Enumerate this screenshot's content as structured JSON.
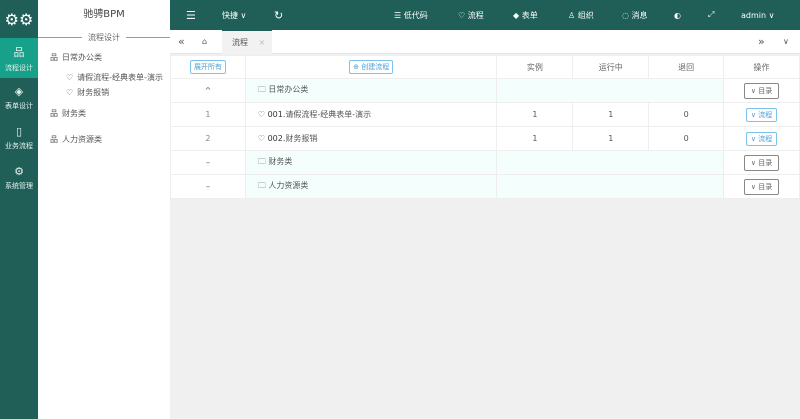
{
  "rail": {
    "items": [
      {
        "label": "流程设计",
        "icon": "sitemap-icon"
      },
      {
        "label": "表单设计",
        "icon": "layers-icon"
      },
      {
        "label": "业务流程",
        "icon": "tablet-icon"
      },
      {
        "label": "系统管理",
        "icon": "gear-icon"
      }
    ]
  },
  "side": {
    "title": "驰骋BPM",
    "section": "流程设计",
    "tree": [
      {
        "label": "日常办公类",
        "children": [
          "请假流程-经典表单-演示",
          "财务报销"
        ]
      },
      {
        "label": "财务类",
        "children": []
      },
      {
        "label": "人力资源类",
        "children": []
      }
    ]
  },
  "topbar": {
    "quick": "快捷",
    "items": [
      "低代码",
      "流程",
      "表单",
      "组织",
      "消息"
    ],
    "user": "admin"
  },
  "tabs": {
    "active": "流程"
  },
  "table": {
    "expand_all": "展开所有",
    "create": "创建流程",
    "headers": [
      "实例",
      "运行中",
      "退回",
      "操作"
    ],
    "rows": [
      {
        "type": "cat",
        "toggle": "^",
        "name": "日常办公类",
        "action": "目录"
      },
      {
        "type": "flow",
        "idx": "1",
        "code": "001.",
        "name": "请假流程-经典表单-演示",
        "c1": "1",
        "c2": "1",
        "c3": "0",
        "action": "流程"
      },
      {
        "type": "flow",
        "idx": "2",
        "code": "002.",
        "name": "财务报销",
        "c1": "1",
        "c2": "1",
        "c3": "0",
        "action": "流程"
      },
      {
        "type": "cat",
        "toggle": "–",
        "name": "财务类",
        "action": "目录"
      },
      {
        "type": "cat",
        "toggle": "–",
        "name": "人力资源类",
        "action": "目录"
      }
    ]
  },
  "colors": {
    "primary": "#1f5f57",
    "active": "#17a08a"
  }
}
